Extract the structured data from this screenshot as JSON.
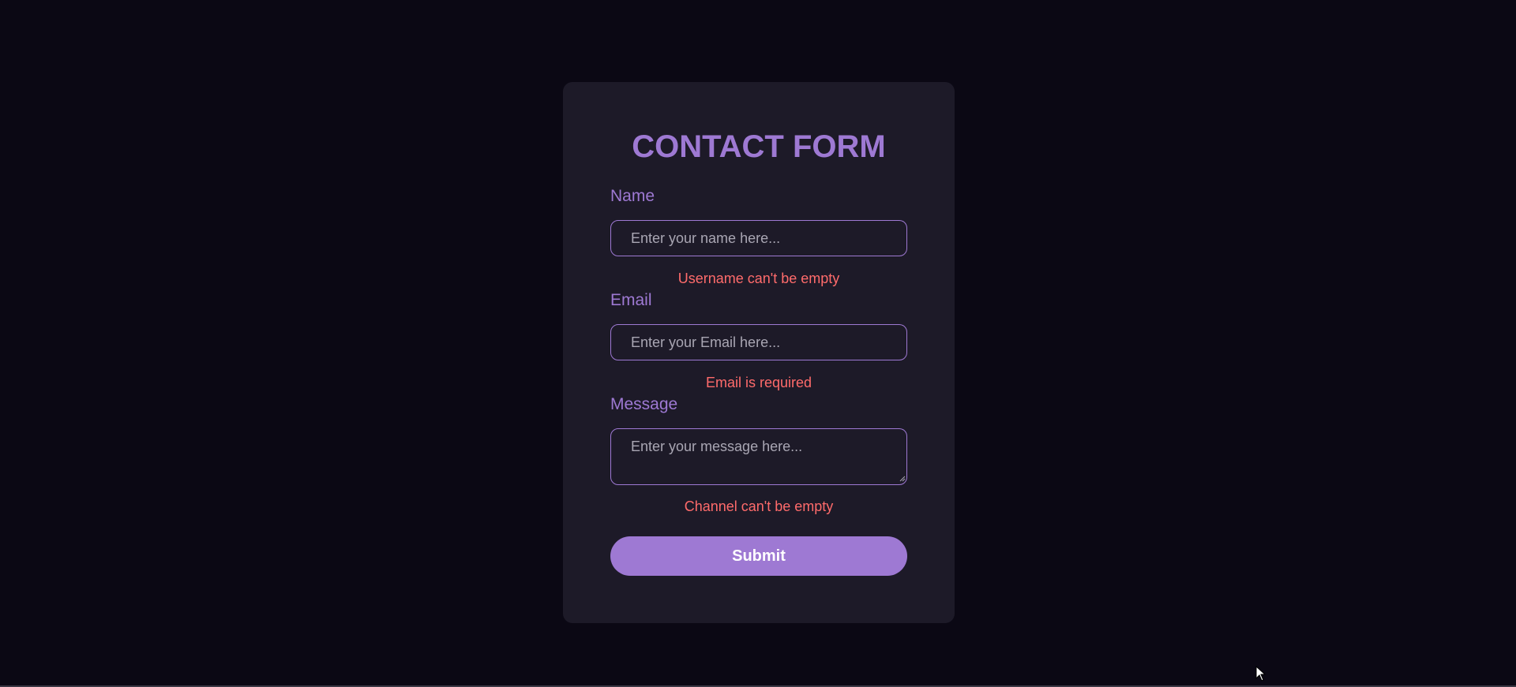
{
  "form": {
    "title": "CONTACT FORM",
    "name": {
      "label": "Name",
      "placeholder": "Enter your name here...",
      "value": "",
      "error": "Username can't be empty"
    },
    "email": {
      "label": "Email",
      "placeholder": "Enter your Email here...",
      "value": "",
      "error": "Email is required"
    },
    "message": {
      "label": "Message",
      "placeholder": "Enter your message here...",
      "value": "",
      "error": "Channel can't be empty"
    },
    "submit_label": "Submit"
  },
  "colors": {
    "background": "#0b0814",
    "card": "#1d1a28",
    "accent": "#9e79d3",
    "error": "#ff6b6b",
    "placeholder": "#a9a6b3"
  },
  "icons": {
    "cursor": "mouse-pointer-icon",
    "resize": "resize-handle-icon"
  }
}
